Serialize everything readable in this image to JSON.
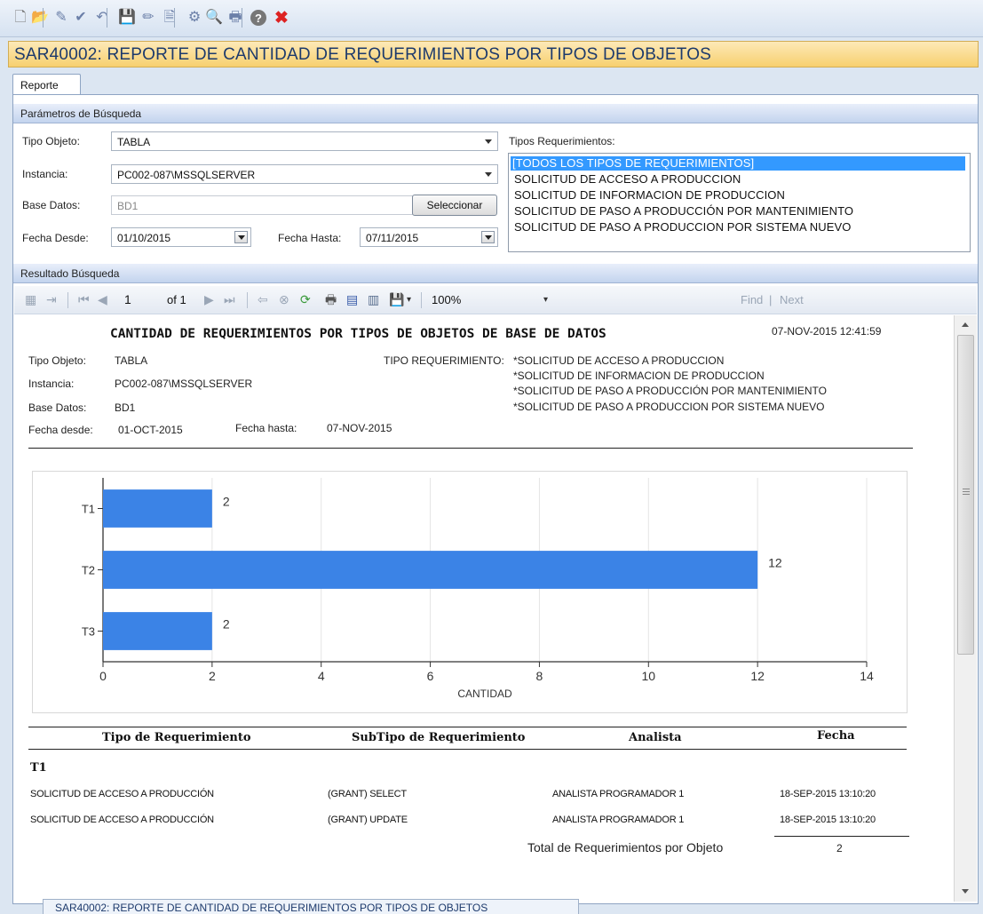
{
  "toolbar": {
    "buttons": [
      {
        "name": "new-icon",
        "glyph": "🗋"
      },
      {
        "name": "open-icon",
        "glyph": "📂"
      },
      {
        "name": "edit-icon",
        "glyph": "✎"
      },
      {
        "name": "approve-icon",
        "glyph": "✔"
      },
      {
        "name": "undo-icon",
        "glyph": "↶"
      },
      {
        "name": "save-icon",
        "glyph": "💾"
      },
      {
        "name": "pencil-icon",
        "glyph": "✏"
      },
      {
        "name": "preview-icon",
        "glyph": "🗎"
      },
      {
        "name": "process-icon",
        "glyph": "⚙"
      },
      {
        "name": "search-icon",
        "glyph": "🔍"
      },
      {
        "name": "print-icon",
        "glyph": "🖶"
      },
      {
        "name": "help-icon",
        "glyph": "?"
      },
      {
        "name": "close-icon",
        "glyph": "✖"
      }
    ]
  },
  "window": {
    "title": "SAR40002: REPORTE DE CANTIDAD DE REQUERIMIENTOS POR TIPOS DE OBJETOS"
  },
  "tabs": {
    "reporte": "Reporte"
  },
  "params": {
    "header": "Parámetros de Búsqueda",
    "tipo_objeto_label": "Tipo Objeto:",
    "tipo_objeto_value": "TABLA",
    "instancia_label": "Instancia:",
    "instancia_value": "PC002-087\\MSSQLSERVER",
    "base_datos_label": "Base Datos:",
    "base_datos_value": "BD1",
    "seleccionar_label": "Seleccionar",
    "fecha_desde_label": "Fecha Desde:",
    "fecha_desde_value": "01/10/2015",
    "fecha_hasta_label": "Fecha Hasta:",
    "fecha_hasta_value": "07/11/2015",
    "tipos_req_label": "Tipos Requerimientos:",
    "tipos_req_items": [
      "[TODOS LOS TIPOS DE REQUERIMIENTOS]",
      "SOLICITUD DE ACCESO A PRODUCCION",
      "SOLICITUD DE INFORMACION DE PRODUCCION",
      "SOLICITUD DE PASO A PRODUCCIÓN POR MANTENIMIENTO",
      "SOLICITUD DE PASO A PRODUCCION POR SISTEMA NUEVO"
    ],
    "selected_index": 0,
    "selected_color": "#3399ff"
  },
  "resultado": {
    "header": "Resultado Búsqueda"
  },
  "viewer": {
    "page": "1",
    "of_label": "of 1",
    "zoom": "100%",
    "find_label": "Find",
    "next_label": "Next"
  },
  "report": {
    "title": "CANTIDAD DE REQUERIMIENTOS POR TIPOS DE OBJETOS DE BASE DE DATOS",
    "timestamp": "07-NOV-2015 12:41:59",
    "tipo_objeto_label": "Tipo Objeto:",
    "tipo_objeto_value": "TABLA",
    "instancia_label": "Instancia:",
    "instancia_value": "PC002-087\\MSSQLSERVER",
    "base_datos_label": "Base Datos:",
    "base_datos_value": "BD1",
    "fecha_desde_label": "Fecha desde:",
    "fecha_desde_value": "01-OCT-2015",
    "fecha_hasta_label": "Fecha hasta:",
    "fecha_hasta_value": "07-NOV-2015",
    "tipo_req_label": "TIPO REQUERIMIENTO:",
    "tipo_req_values": [
      "*SOLICITUD DE ACCESO A PRODUCCION",
      "*SOLICITUD DE INFORMACION DE PRODUCCION",
      "*SOLICITUD DE PASO A PRODUCCIÓN POR MANTENIMIENTO",
      "*SOLICITUD DE PASO A PRODUCCION POR SISTEMA NUEVO"
    ],
    "table": {
      "headers": [
        "Tipo de Requerimiento",
        "SubTipo de Requerimiento",
        "Analista",
        "Fecha"
      ],
      "group": "T1",
      "rows": [
        [
          "SOLICITUD DE ACCESO A PRODUCCIÓN",
          "(GRANT) SELECT",
          "ANALISTA PROGRAMADOR 1",
          "18-SEP-2015 13:10:20"
        ],
        [
          "SOLICITUD DE ACCESO A PRODUCCIÓN",
          "(GRANT) UPDATE",
          "ANALISTA PROGRAMADOR 1",
          "18-SEP-2015 13:10:20"
        ]
      ],
      "total_label": "Total de Requerimientos por Objeto",
      "total_value": "2"
    }
  },
  "chart_data": {
    "type": "bar",
    "orientation": "horizontal",
    "categories": [
      "T1",
      "T2",
      "T3"
    ],
    "values": [
      2,
      12,
      2
    ],
    "xlabel": "CANTIDAD",
    "ylabel": "",
    "xlim": [
      0,
      14
    ],
    "xticks": [
      0,
      2,
      4,
      6,
      8,
      10,
      12,
      14
    ],
    "grid": true,
    "data_labels": true,
    "bar_color": "#3b83e6"
  },
  "statusbar": {
    "tab": "SAR40002: REPORTE DE CANTIDAD DE REQUERIMIENTOS POR TIPOS DE OBJETOS"
  }
}
